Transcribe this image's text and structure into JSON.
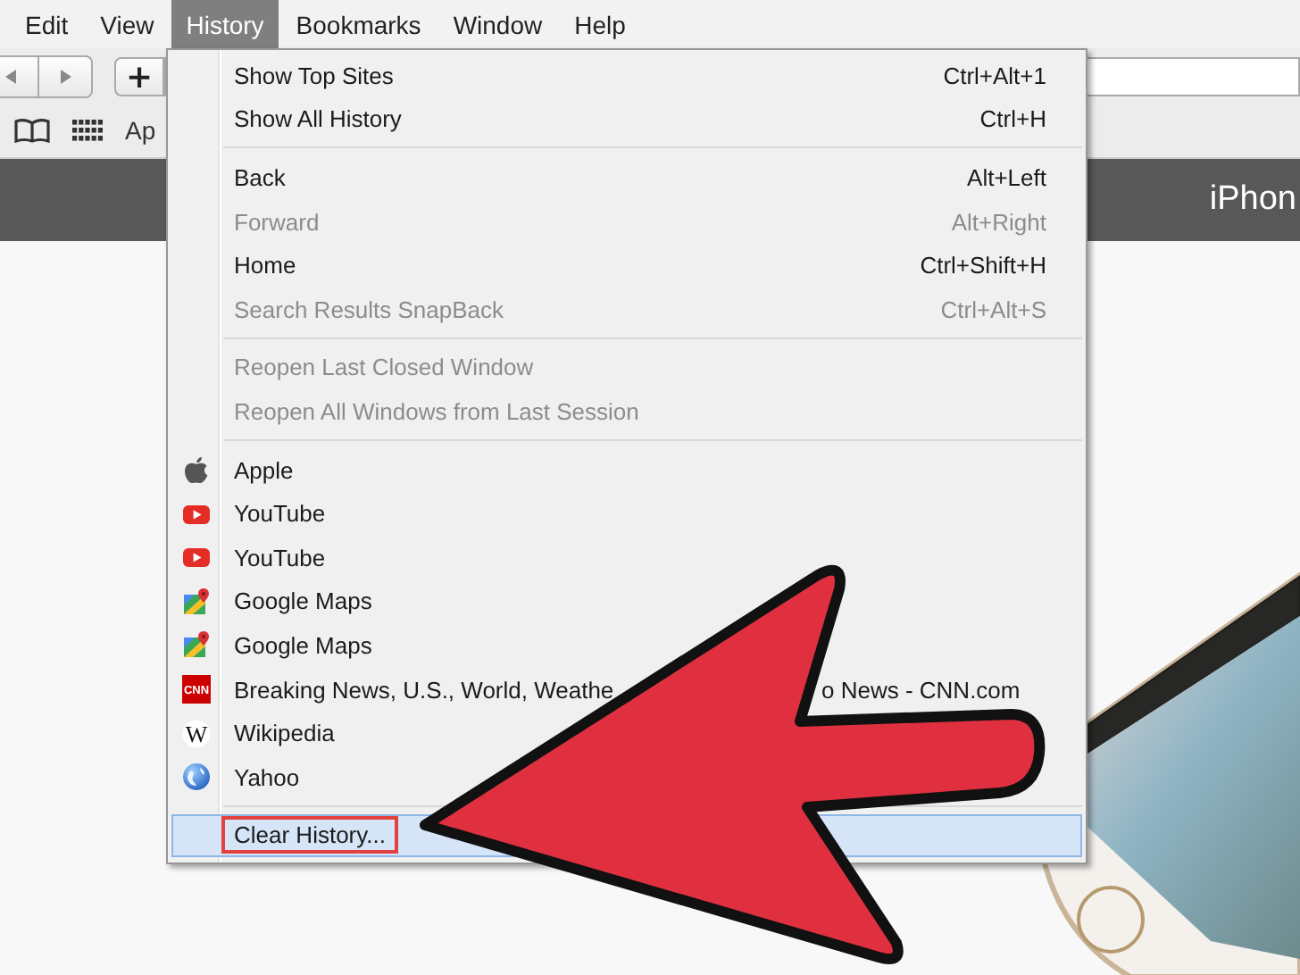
{
  "menu_bar": [
    {
      "label": "Edit",
      "selected": false
    },
    {
      "label": "View",
      "selected": false
    },
    {
      "label": "History",
      "selected": true
    },
    {
      "label": "Bookmarks",
      "selected": false
    },
    {
      "label": "Window",
      "selected": false
    },
    {
      "label": "Help",
      "selected": false
    }
  ],
  "toolbar": {
    "new_tab_button": "+"
  },
  "bookmarks_bar": {
    "item": "Ap"
  },
  "banner": {
    "title": "iPhon"
  },
  "history_menu": {
    "items": [
      {
        "kind": "command",
        "label": "Show Top Sites",
        "shortcut": "Ctrl+Alt+1",
        "disabled": false,
        "selected": false
      },
      {
        "kind": "command",
        "label": "Show All History",
        "shortcut": "Ctrl+H",
        "disabled": false,
        "selected": false
      },
      {
        "kind": "separator"
      },
      {
        "kind": "command",
        "label": "Back",
        "shortcut": "Alt+Left",
        "disabled": false,
        "selected": false
      },
      {
        "kind": "command",
        "label": "Forward",
        "shortcut": "Alt+Right",
        "disabled": true,
        "selected": false
      },
      {
        "kind": "command",
        "label": "Home",
        "shortcut": "Ctrl+Shift+H",
        "disabled": false,
        "selected": false
      },
      {
        "kind": "command",
        "label": "Search Results SnapBack",
        "shortcut": "Ctrl+Alt+S",
        "disabled": true,
        "selected": false
      },
      {
        "kind": "separator"
      },
      {
        "kind": "command",
        "label": "Reopen Last Closed Window",
        "disabled": true,
        "selected": false
      },
      {
        "kind": "command",
        "label": "Reopen All Windows from Last Session",
        "disabled": true,
        "selected": false
      },
      {
        "kind": "separator"
      },
      {
        "kind": "apple",
        "label": "Apple",
        "selected": false
      },
      {
        "kind": "video",
        "label": "YouTube",
        "selected": false
      },
      {
        "kind": "video",
        "label": "YouTube",
        "selected": false
      },
      {
        "kind": "map",
        "label": "Google Maps",
        "selected": false
      },
      {
        "kind": "map",
        "label": "Google Maps",
        "selected": false
      },
      {
        "kind": "news",
        "glyph": "CNN",
        "label": "Breaking News, U.S., World, Weathe",
        "label_tail": "o News - CNN.com",
        "selected": false
      },
      {
        "kind": "wiki",
        "glyph": "W",
        "label": "Wikipedia",
        "selected": false
      },
      {
        "kind": "globe",
        "label": "Yahoo",
        "selected": false
      },
      {
        "kind": "separator"
      },
      {
        "kind": "command",
        "label": "Clear History...",
        "disabled": false,
        "selected": true,
        "outlined": true
      }
    ]
  }
}
